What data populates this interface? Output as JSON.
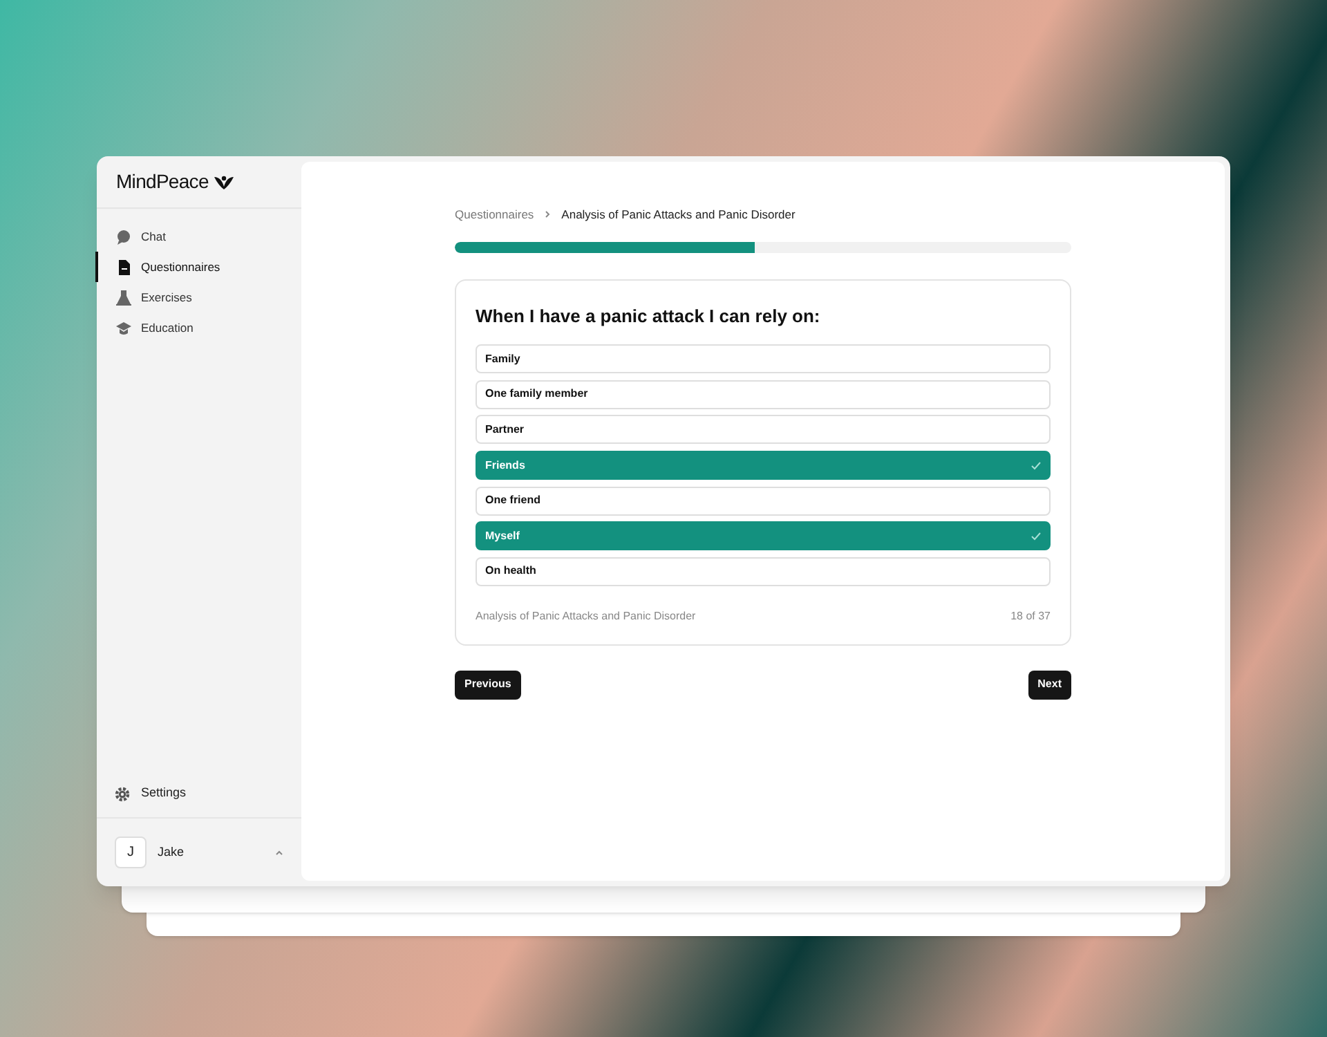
{
  "sidebar": {
    "logo": "MindPeace",
    "items": [
      {
        "label": "Chat",
        "kind": "chat",
        "selected": false
      },
      {
        "label": "Questionnaires",
        "kind": "document",
        "selected": true
      },
      {
        "label": "Exercises",
        "kind": "flask",
        "selected": false
      },
      {
        "label": "Education",
        "kind": "cap",
        "selected": false
      }
    ],
    "settings": "Settings",
    "user": {
      "initial": "J",
      "name": "Jake"
    }
  },
  "breadcrumb": [
    "Questionnaires",
    "Analysis of Panic Attacks and Panic Disorder"
  ],
  "progress": {
    "level": 0.487
  },
  "question": {
    "title": "When I have a panic attack I can rely on:",
    "options": [
      {
        "label": "Family",
        "selected": false
      },
      {
        "label": "One family member",
        "selected": false
      },
      {
        "label": "Partner",
        "selected": false
      },
      {
        "label": "Friends",
        "selected": true
      },
      {
        "label": "One friend",
        "selected": false
      },
      {
        "label": "Myself",
        "selected": true
      },
      {
        "label": "On health",
        "selected": false
      }
    ],
    "footer": "Analysis of Panic Attacks and Panic Disorder",
    "counter": "18 of 37"
  },
  "buttons": [
    "Previous",
    "Next"
  ]
}
